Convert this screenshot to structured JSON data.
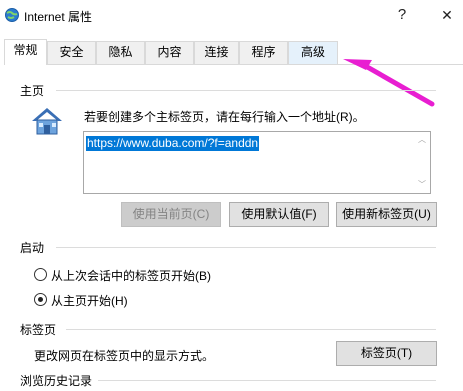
{
  "window": {
    "title": "Internet 属性",
    "help_glyph": "?",
    "close_glyph": "✕"
  },
  "tabs": [
    {
      "label": "常规",
      "active": true
    },
    {
      "label": "安全",
      "active": false
    },
    {
      "label": "隐私",
      "active": false
    },
    {
      "label": "内容",
      "active": false
    },
    {
      "label": "连接",
      "active": false
    },
    {
      "label": "程序",
      "active": false
    },
    {
      "label": "高级",
      "active": false
    }
  ],
  "annotation": {
    "color": "#e81ed1",
    "target": "高级"
  },
  "homepage": {
    "heading": "主页",
    "instruction": "若要创建多个主标签页，请在每行输入一个地址(R)。",
    "url": "https://www.duba.com/?f=anddn",
    "buttons": {
      "use_current": "使用当前页(C)",
      "use_default": "使用默认值(F)",
      "use_new_tab": "使用新标签页(U)"
    }
  },
  "startup": {
    "heading": "启动",
    "option_last_session": "从上次会话中的标签页开始(B)",
    "option_homepage": "从主页开始(H)",
    "selected": "option_homepage"
  },
  "tabs_section": {
    "heading": "标签页",
    "description": "更改网页在标签页中的显示方式。",
    "button": "标签页(T)"
  },
  "history": {
    "heading": "浏览历史记录"
  },
  "colors": {
    "selection": "#0078d7",
    "annotation_arrow": "#e81ed1"
  }
}
